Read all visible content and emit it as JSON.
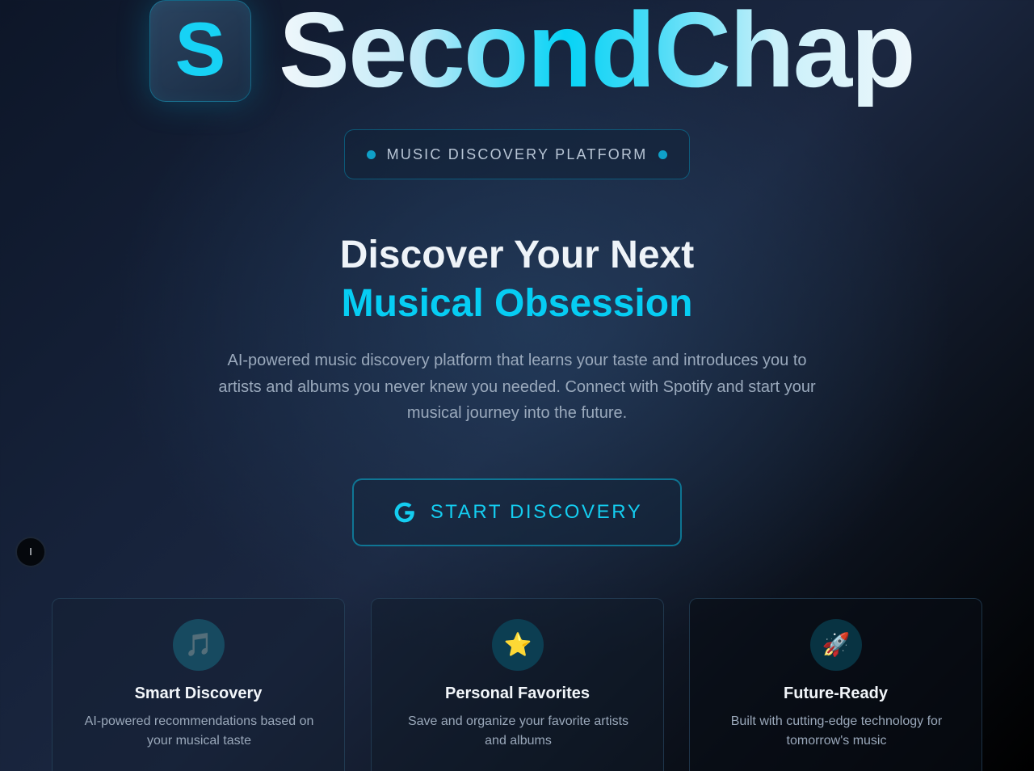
{
  "brand": {
    "logo_letter": "S",
    "name": "SecondChap",
    "logo_icon": "s-logo-icon"
  },
  "badge": {
    "label": "MUSIC DISCOVERY PLATFORM"
  },
  "hero": {
    "title_line1": "Discover Your Next",
    "title_line2": "Musical Obsession",
    "description": "AI-powered music discovery platform that learns your taste and introduces you to artists and albums you never knew you needed. Connect with Spotify and start your musical journey into the future."
  },
  "cta": {
    "label": "START DISCOVERY",
    "icon": "google-g-icon"
  },
  "floating_button": {
    "label": "I"
  },
  "features": [
    {
      "icon": "🎵",
      "icon_name": "music-note-icon",
      "title": "Smart Discovery",
      "description": "AI-powered recommendations based on your musical taste"
    },
    {
      "icon": "⭐",
      "icon_name": "star-icon",
      "title": "Personal Favorites",
      "description": "Save and organize your favorite artists and albums"
    },
    {
      "icon": "🚀",
      "icon_name": "rocket-icon",
      "title": "Future-Ready",
      "description": "Built with cutting-edge technology for tomorrow's music"
    }
  ],
  "colors": {
    "accent": "#06cdf3",
    "background_dark": "#0d1628",
    "text_primary": "#eef3f8",
    "text_muted": "#9aa9bc"
  }
}
